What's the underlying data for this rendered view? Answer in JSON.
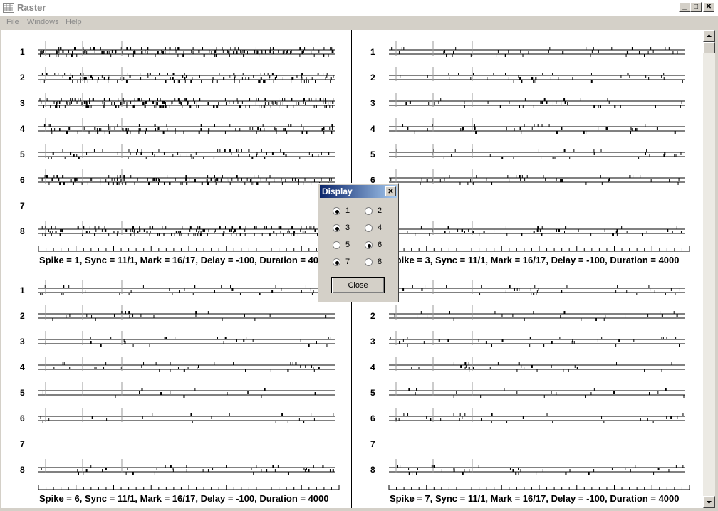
{
  "window": {
    "title": "Raster",
    "minimize_label": "_",
    "maximize_label": "□",
    "close_label": "✕",
    "icon": "raster-app-icon"
  },
  "menu": {
    "items": [
      "File",
      "Windows",
      "Help"
    ]
  },
  "channel_labels": [
    "1",
    "2",
    "3",
    "4",
    "5",
    "6",
    "7",
    "8"
  ],
  "panels": [
    {
      "caption": "Spike = 1, Sync = 11/1, Mark = 16/17, Delay = -100, Duration = 4000",
      "density": [
        34,
        28,
        40,
        26,
        22,
        34,
        0,
        36
      ]
    },
    {
      "caption": "Spike = 3, Sync = 11/1, Mark = 16/17, Delay = -100, Duration = 4000",
      "density": [
        10,
        9,
        10,
        9,
        8,
        10,
        0,
        12
      ]
    },
    {
      "caption": "Spike = 6, Sync = 11/1, Mark = 16/17, Delay = -100, Duration = 4000",
      "density": [
        8,
        7,
        8,
        9,
        4,
        6,
        0,
        10
      ]
    },
    {
      "caption": "Spike = 7, Sync = 11/1, Mark = 16/17, Delay = -100, Duration = 4000",
      "density": [
        7,
        6,
        8,
        8,
        5,
        7,
        0,
        8
      ]
    }
  ],
  "dialog": {
    "title": "Display",
    "close_icon_label": "✕",
    "options": [
      {
        "label": "1",
        "checked": true
      },
      {
        "label": "2",
        "checked": false
      },
      {
        "label": "3",
        "checked": true
      },
      {
        "label": "4",
        "checked": false
      },
      {
        "label": "5",
        "checked": false
      },
      {
        "label": "6",
        "checked": true
      },
      {
        "label": "7",
        "checked": true
      },
      {
        "label": "8",
        "checked": false
      }
    ],
    "close_button": "Close"
  }
}
